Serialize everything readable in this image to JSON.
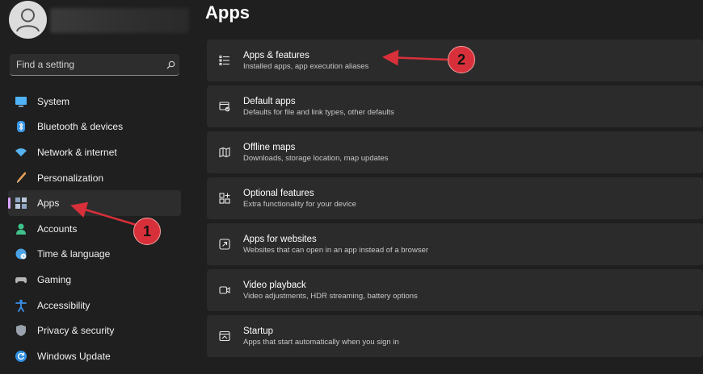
{
  "sidebar": {
    "search_placeholder": "Find a setting",
    "items": [
      {
        "label": "System",
        "icon": "monitor-icon",
        "color": "#4fb3f6"
      },
      {
        "label": "Bluetooth & devices",
        "icon": "bluetooth-icon",
        "color": "#3a96e6"
      },
      {
        "label": "Network & internet",
        "icon": "wifi-icon",
        "color": "#57b3ef"
      },
      {
        "label": "Personalization",
        "icon": "brush-icon",
        "color": "#e8a15a"
      },
      {
        "label": "Apps",
        "icon": "apps-icon",
        "color": "#8fa6c4",
        "active": true
      },
      {
        "label": "Accounts",
        "icon": "person-icon",
        "color": "#3fc28a"
      },
      {
        "label": "Time & language",
        "icon": "globe-clock-icon",
        "color": "#4aa3e6"
      },
      {
        "label": "Gaming",
        "icon": "controller-icon",
        "color": "#b5b5b5"
      },
      {
        "label": "Accessibility",
        "icon": "accessibility-icon",
        "color": "#3b8fe8"
      },
      {
        "label": "Privacy & security",
        "icon": "shield-icon",
        "color": "#9aa3ad"
      },
      {
        "label": "Windows Update",
        "icon": "refresh-icon",
        "color": "#2f8fe3"
      }
    ]
  },
  "main": {
    "title": "Apps",
    "cards": [
      {
        "title": "Apps & features",
        "subtitle": "Installed apps, app execution aliases",
        "icon": "list-icon"
      },
      {
        "title": "Default apps",
        "subtitle": "Defaults for file and link types, other defaults",
        "icon": "default-apps-icon"
      },
      {
        "title": "Offline maps",
        "subtitle": "Downloads, storage location, map updates",
        "icon": "map-icon"
      },
      {
        "title": "Optional features",
        "subtitle": "Extra functionality for your device",
        "icon": "add-grid-icon"
      },
      {
        "title": "Apps for websites",
        "subtitle": "Websites that can open in an app instead of a browser",
        "icon": "open-in-app-icon"
      },
      {
        "title": "Video playback",
        "subtitle": "Video adjustments, HDR streaming, battery options",
        "icon": "video-icon"
      },
      {
        "title": "Startup",
        "subtitle": "Apps that start automatically when you sign in",
        "icon": "startup-icon"
      }
    ]
  },
  "annotations": [
    {
      "number": "1"
    },
    {
      "number": "2"
    }
  ],
  "colors": {
    "accent": "#d9a3ff",
    "annotation": "#d8303a"
  }
}
